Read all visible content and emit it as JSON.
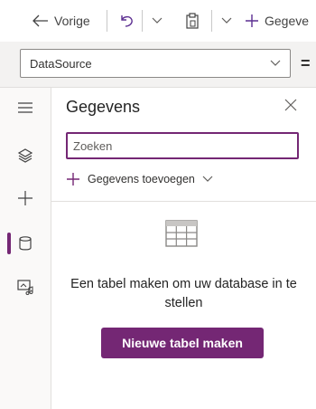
{
  "toolbar": {
    "back_label": "Vorige",
    "data_label": "Gegeve"
  },
  "formula_bar": {
    "property_value": "DataSource",
    "equals": "="
  },
  "rail": {
    "items": [
      "menu-icon",
      "layers-icon",
      "plus-icon",
      "database-icon",
      "media-icon"
    ],
    "active": "database-icon"
  },
  "panel": {
    "title": "Gegevens",
    "search_placeholder": "Zoeken",
    "add_data_label": "Gegevens toevoegen",
    "empty_message": "Een tabel maken om uw database in te stellen",
    "create_table_label": "Nieuwe tabel maken"
  },
  "colors": {
    "accent": "#742774",
    "rail_bg": "#faf9f8",
    "formula_bg": "#f3f2f1"
  }
}
